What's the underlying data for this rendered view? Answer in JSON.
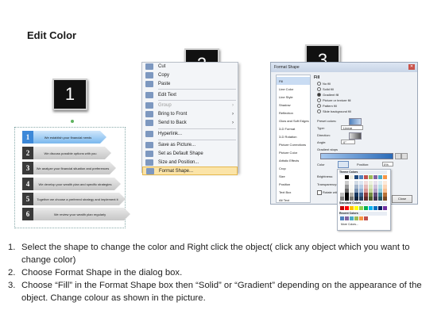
{
  "page": {
    "title": "Edit Color"
  },
  "badges": [
    "1",
    "2",
    "3"
  ],
  "slide": {
    "rows": [
      {
        "num": "1",
        "text": "We establish your financial needs"
      },
      {
        "num": "2",
        "text": "We discuss possible options with you"
      },
      {
        "num": "3",
        "text": "We analyze your financial situation and preferences"
      },
      {
        "num": "4",
        "text": "We develop your wealth plan and specific strategies"
      },
      {
        "num": "5",
        "text": "Together we choose a preferred strategy and implement it"
      },
      {
        "num": "6",
        "text": "We review your wealth plan regularly"
      }
    ]
  },
  "context_menu": {
    "items": [
      {
        "label": "Cut",
        "disabled": false,
        "submenu": false
      },
      {
        "label": "Copy",
        "disabled": false,
        "submenu": false
      },
      {
        "label": "Paste",
        "disabled": false,
        "submenu": false
      },
      {
        "label": "Edit Text",
        "disabled": false,
        "submenu": false
      },
      {
        "label": "Group",
        "disabled": true,
        "submenu": true
      },
      {
        "label": "Bring to Front",
        "disabled": false,
        "submenu": true
      },
      {
        "label": "Send to Back",
        "disabled": false,
        "submenu": true
      },
      {
        "label": "Hyperlink...",
        "disabled": false,
        "submenu": false
      },
      {
        "label": "Save as Picture...",
        "disabled": false,
        "submenu": false
      },
      {
        "label": "Set as Default Shape",
        "disabled": false,
        "submenu": false
      },
      {
        "label": "Size and Position...",
        "disabled": false,
        "submenu": false
      },
      {
        "label": "Format Shape...",
        "disabled": false,
        "submenu": false,
        "highlighted": true
      }
    ]
  },
  "dialog": {
    "title": "Format Shape",
    "nav": [
      "Fill",
      "Line Color",
      "Line Style",
      "Shadow",
      "Reflection",
      "Glow and Soft Edges",
      "3-D Format",
      "3-D Rotation",
      "Picture Corrections",
      "Picture Color",
      "Artistic Effects",
      "Crop",
      "Size",
      "Position",
      "Text Box",
      "Alt Text"
    ],
    "section": "Fill",
    "options": [
      "No fill",
      "Solid fill",
      "Gradient fill",
      "Picture or texture fill",
      "Pattern fill",
      "Slide background fill"
    ],
    "fields": {
      "preset": "Preset colors:",
      "type": "Type:",
      "type_value": "Linear",
      "direction": "Direction:",
      "angle": "Angle:",
      "angle_value": "0°",
      "stops": "Gradient stops",
      "color": "Color",
      "position": "Position:",
      "position_value": "0%",
      "brightness": "Brightness:",
      "transparency": "Transparency:",
      "rotate": "Rotate with shape"
    },
    "close": "Close"
  },
  "palette": {
    "theme_label": "Theme Colors",
    "standard_label": "Standard Colors",
    "recent_label": "Recent Colors",
    "more_label": "More Colors...",
    "theme_top": [
      "#ffffff",
      "#000000",
      "#eeece1",
      "#1f497d",
      "#4f81bd",
      "#c0504d",
      "#9bbb59",
      "#8064a2",
      "#4bacc6",
      "#f79646"
    ],
    "standard": [
      "#c00000",
      "#ff0000",
      "#ffc000",
      "#ffff00",
      "#92d050",
      "#00b050",
      "#00b0f0",
      "#0070c0",
      "#002060",
      "#7030a0"
    ],
    "recent": [
      "#4f81bd",
      "#8064a2",
      "#4bacc6",
      "#9bbb59",
      "#f79646",
      "#c0504d"
    ]
  },
  "instructions": [
    {
      "n": "1.",
      "text": "Select the shape to change the color and Right click the object( click any object which you want to change color)"
    },
    {
      "n": "2.",
      "text": "Choose Format Shape in the dialog box."
    },
    {
      "n": "3.",
      "text": "Choose “Fill” in the Format Shape box then “Solid” or “Gradient” depending on the appearance of the object. Change colour as shown in the picture."
    }
  ]
}
